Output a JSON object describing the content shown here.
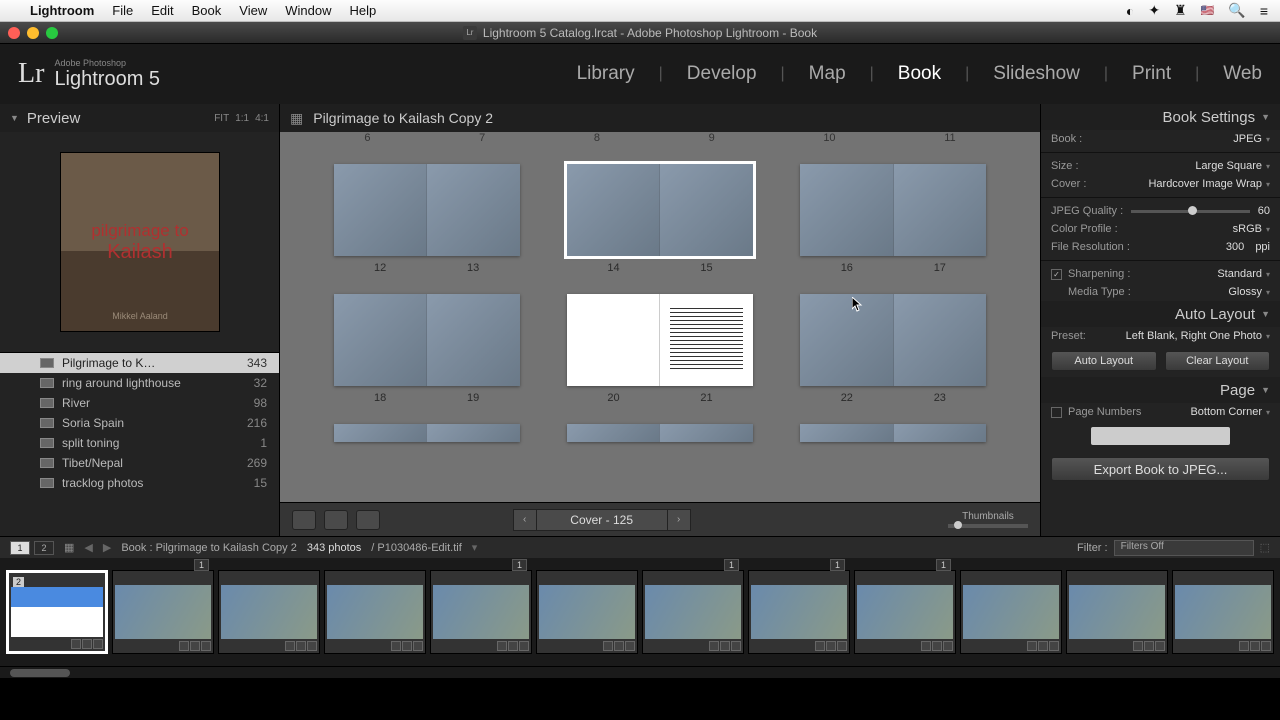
{
  "mac_menu": {
    "app": "Lightroom",
    "items": [
      "File",
      "Edit",
      "Book",
      "View",
      "Window",
      "Help"
    ]
  },
  "window_title": "Lightroom 5 Catalog.lrcat - Adobe Photoshop Lightroom - Book",
  "identity": {
    "small": "Adobe Photoshop",
    "main": "Lightroom 5",
    "mark": "Lr"
  },
  "modules": [
    "Library",
    "Develop",
    "Map",
    "Book",
    "Slideshow",
    "Print",
    "Web"
  ],
  "active_module": "Book",
  "left": {
    "header": "Preview",
    "fit_modes": [
      "FIT",
      "1:1",
      "4:1"
    ],
    "cover": {
      "line1": "pilgrimage to",
      "line2": "Kailash",
      "author": "Mikkel Aaland"
    },
    "collections": [
      {
        "name": "Pilgrimage to K…",
        "count": 343,
        "active": true
      },
      {
        "name": "ring around lighthouse",
        "count": 32
      },
      {
        "name": "River",
        "count": 98
      },
      {
        "name": "Soria Spain",
        "count": 216
      },
      {
        "name": "split toning",
        "count": 1
      },
      {
        "name": "Tibet/Nepal",
        "count": 269
      },
      {
        "name": "tracklog photos",
        "count": 15
      }
    ]
  },
  "center": {
    "title": "Pilgrimage to Kailash Copy 2",
    "top_nums": [
      "6",
      "7",
      "8",
      "9",
      "10",
      "11"
    ],
    "spreads": [
      [
        {
          "l": 12,
          "r": 13
        },
        {
          "l": 14,
          "r": 15,
          "sel": true
        },
        {
          "l": 16,
          "r": 17
        }
      ],
      [
        {
          "l": 18,
          "r": 19
        },
        {
          "l": 20,
          "r": 21,
          "text": true
        },
        {
          "l": 22,
          "r": 23
        }
      ]
    ],
    "pager": "Cover - 125",
    "thumb_label": "Thumbnails"
  },
  "right": {
    "sections": {
      "book_settings": "Book Settings",
      "auto_layout": "Auto Layout",
      "page": "Page"
    },
    "settings": {
      "book": {
        "lbl": "Book :",
        "val": "JPEG"
      },
      "size": {
        "lbl": "Size :",
        "val": "Large Square"
      },
      "cover": {
        "lbl": "Cover :",
        "val": "Hardcover Image Wrap"
      },
      "jpeg_q": {
        "lbl": "JPEG Quality :",
        "val": "60"
      },
      "color_profile": {
        "lbl": "Color Profile :",
        "val": "sRGB"
      },
      "file_res": {
        "lbl": "File Resolution :",
        "val": "300",
        "unit": "ppi"
      },
      "sharpening": {
        "lbl": "Sharpening :",
        "val": "Standard",
        "checked": true
      },
      "media_type": {
        "lbl": "Media Type :",
        "val": "Glossy"
      }
    },
    "preset": {
      "lbl": "Preset:",
      "val": "Left Blank, Right One Photo"
    },
    "buttons": {
      "auto": "Auto Layout",
      "clear": "Clear Layout"
    },
    "page_numbers": {
      "lbl": "Page Numbers",
      "val": "Bottom Corner"
    },
    "export": "Export Book to JPEG..."
  },
  "filmstrip_bar": {
    "screens": [
      "1",
      "2"
    ],
    "path": "Book : Pilgrimage to Kailash Copy 2",
    "count": "343 photos",
    "current": "/ P1030486-Edit.tif",
    "filter_lbl": "Filter :",
    "filter_val": "Filters Off"
  },
  "filmstrip": {
    "badges": [
      "",
      "1",
      "",
      "",
      "1",
      "",
      "1",
      "1",
      "1",
      "",
      "",
      ""
    ],
    "sel_index": 0,
    "sel_num": "2"
  }
}
